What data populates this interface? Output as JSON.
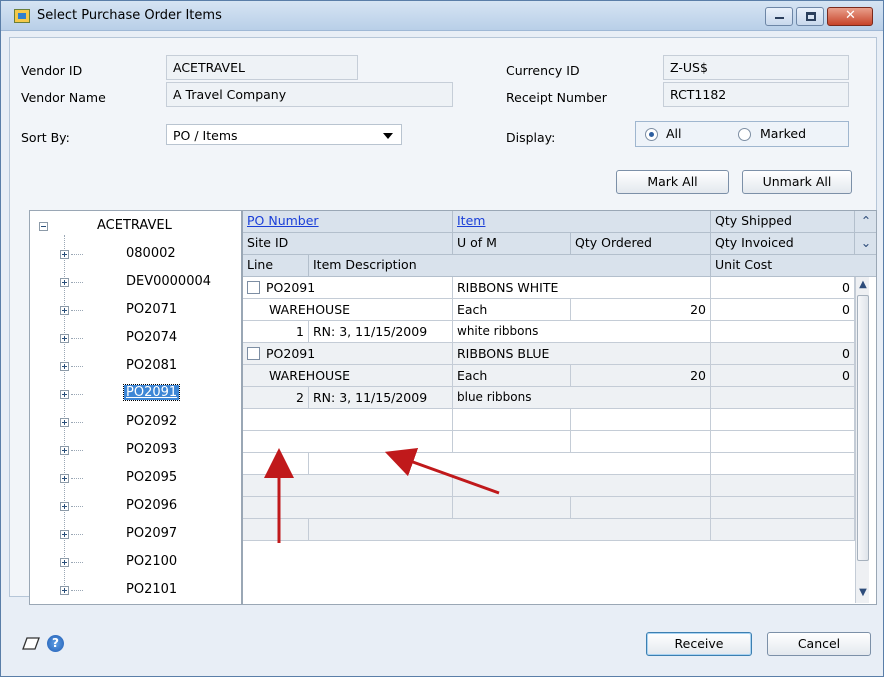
{
  "window": {
    "title": "Select Purchase Order Items",
    "controls": {
      "minimize": "▁",
      "maximize": "□",
      "close": "✕"
    }
  },
  "header": {
    "vendor_id_label": "Vendor ID",
    "vendor_id": "ACETRAVEL",
    "vendor_name_label": "Vendor Name",
    "vendor_name": "A Travel Company",
    "currency_id_label": "Currency ID",
    "currency_id": "Z-US$",
    "receipt_number_label": "Receipt Number",
    "receipt_number": "RCT1182",
    "sort_by_label": "Sort By:",
    "sort_by_value": "PO / Items",
    "display_label": "Display:",
    "display_options": [
      "All",
      "Marked"
    ],
    "display_selected": "All"
  },
  "toolbar": {
    "mark_all": "Mark All",
    "unmark_all": "Unmark All"
  },
  "tree": {
    "root": "ACETRAVEL",
    "items": [
      "080002",
      "DEV0000004",
      "PO2071",
      "PO2074",
      "PO2081",
      "PO2091",
      "PO2092",
      "PO2093",
      "PO2095",
      "PO2096",
      "PO2097",
      "PO2100",
      "PO2101"
    ],
    "selected": "PO2091"
  },
  "grid": {
    "headers": {
      "po_number": "PO Number",
      "item": "Item",
      "qty_shipped": "Qty Shipped",
      "site_id": "Site ID",
      "u_of_m": "U of M",
      "qty_ordered": "Qty Ordered",
      "qty_invoiced": "Qty Invoiced",
      "line": "Line",
      "item_description": "Item Description",
      "unit_cost": "Unit Cost"
    },
    "rows": [
      {
        "po_number": "PO2091",
        "item": "RIBBONS WHITE",
        "qty_shipped": "0",
        "site_id": "WAREHOUSE",
        "u_of_m": "Each",
        "qty_ordered": "20",
        "qty_invoiced": "0",
        "line": "1",
        "receipt_ref": "RN: 3, 11/15/2009",
        "item_description": "white ribbons"
      },
      {
        "po_number": "PO2091",
        "item": "RIBBONS BLUE",
        "qty_shipped": "0",
        "site_id": "WAREHOUSE",
        "u_of_m": "Each",
        "qty_ordered": "20",
        "qty_invoiced": "0",
        "line": "2",
        "receipt_ref": "RN: 3, 11/15/2009",
        "item_description": "blue ribbons"
      }
    ]
  },
  "footer": {
    "receive": "Receive",
    "cancel": "Cancel",
    "help_icon": "?"
  },
  "colors": {
    "arrow": "#c0191b",
    "link": "#1a3fd8",
    "selection": "#3d86d6"
  }
}
